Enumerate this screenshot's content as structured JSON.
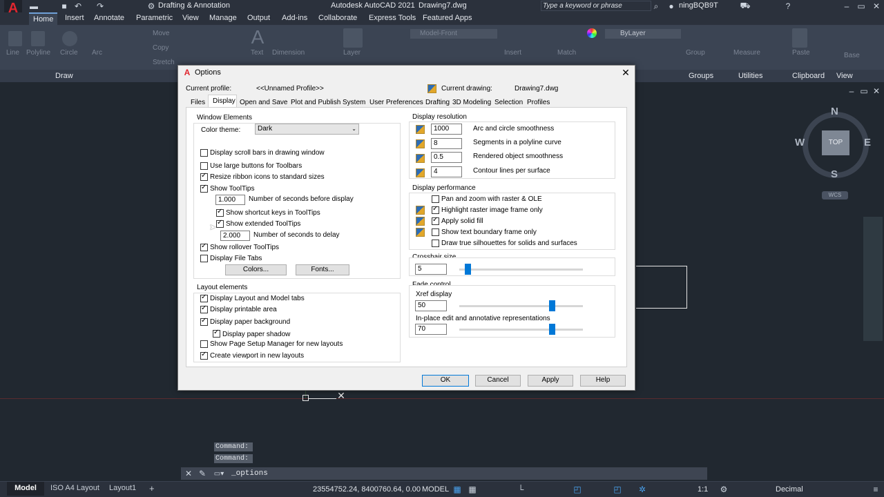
{
  "titlebar": {
    "workspace": "Drafting & Annotation",
    "app_title": "Autodesk AutoCAD 2021",
    "file": "Drawing7.dwg",
    "search_placeholder": "Type a keyword or phrase",
    "user": "ningBQB9T"
  },
  "ribbon_tabs": [
    "Home",
    "Insert",
    "Annotate",
    "Parametric",
    "View",
    "Manage",
    "Output",
    "Add-ins",
    "Collaborate",
    "Express Tools",
    "Featured Apps"
  ],
  "ribbon": {
    "tools": [
      "Line",
      "Polyline",
      "Circle",
      "Arc",
      "Move",
      "Copy",
      "Stretch",
      "Text",
      "Dimension",
      "Layer",
      "Insert",
      "Match",
      "Group",
      "Measure",
      "Paste",
      "Base"
    ],
    "layer_state": "Model-Front",
    "bylayer": "ByLayer",
    "panels": [
      "Draw",
      "Groups",
      "Utilities",
      "Clipboard",
      "View"
    ]
  },
  "viewcube": {
    "n": "N",
    "s": "S",
    "e": "E",
    "w": "W",
    "top": "TOP",
    "wcs": "WCS"
  },
  "command": {
    "line1": "Command:",
    "line2": "Command:",
    "input": "_options"
  },
  "status": {
    "tabs": [
      "Model",
      "ISO A4 Layout",
      "Layout1"
    ],
    "coords": "23554752.24, 8400760.64, 0.00",
    "mode": "MODEL",
    "scale": "1:1",
    "units": "Decimal"
  },
  "dialog": {
    "title": "Options",
    "current_profile_label": "Current profile:",
    "current_profile": "<<Unnamed Profile>>",
    "current_drawing_label": "Current drawing:",
    "current_drawing": "Drawing7.dwg",
    "tabs": [
      "Files",
      "Display",
      "Open and Save",
      "Plot and Publish",
      "System",
      "User Preferences",
      "Drafting",
      "3D Modeling",
      "Selection",
      "Profiles"
    ],
    "window_elements": {
      "title": "Window Elements",
      "color_theme_label": "Color theme:",
      "color_theme": "Dark",
      "scroll_bars": "Display scroll bars in drawing window",
      "large_buttons": "Use large buttons for Toolbars",
      "resize_ribbon": "Resize ribbon icons to standard sizes",
      "show_tooltips": "Show ToolTips",
      "seconds_value": "1.000",
      "seconds_label": "Number of seconds before display",
      "shortcut_keys": "Show shortcut keys in ToolTips",
      "extended": "Show extended ToolTips",
      "delay_value": "2.000",
      "delay_label": "Number of seconds to delay",
      "rollover": "Show rollover ToolTips",
      "file_tabs": "Display File Tabs",
      "colors_btn": "Colors...",
      "fonts_btn": "Fonts..."
    },
    "layout_elements": {
      "title": "Layout elements",
      "layout_model_tabs": "Display Layout and Model tabs",
      "printable_area": "Display printable area",
      "paper_background": "Display paper background",
      "paper_shadow": "Display paper shadow",
      "page_setup": "Show Page Setup Manager for new layouts",
      "create_viewport": "Create viewport in new layouts"
    },
    "display_resolution": {
      "title": "Display resolution",
      "rows": [
        {
          "value": "1000",
          "label": "Arc and circle smoothness"
        },
        {
          "value": "8",
          "label": "Segments in a polyline curve"
        },
        {
          "value": "0.5",
          "label": "Rendered object smoothness"
        },
        {
          "value": "4",
          "label": "Contour lines per surface"
        }
      ]
    },
    "display_performance": {
      "title": "Display performance",
      "pan_zoom": "Pan and zoom with raster & OLE",
      "highlight_raster": "Highlight raster image frame only",
      "apply_solid": "Apply solid fill",
      "text_boundary": "Show text boundary frame only",
      "silhouettes": "Draw true silhouettes for solids and surfaces"
    },
    "crosshair": {
      "title": "Crosshair size",
      "value": "5"
    },
    "fade": {
      "title": "Fade control",
      "xref_label": "Xref display",
      "xref_value": "50",
      "inplace_label": "In-place edit and annotative representations",
      "inplace_value": "70"
    },
    "buttons": {
      "ok": "OK",
      "cancel": "Cancel",
      "apply": "Apply",
      "help": "Help"
    }
  }
}
